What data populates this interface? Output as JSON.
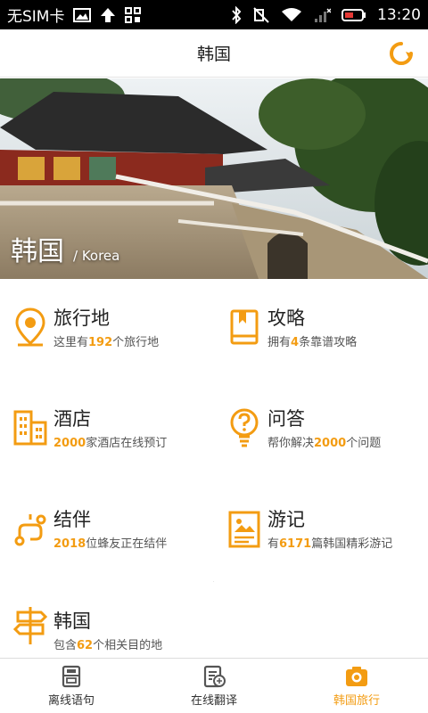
{
  "status_bar": {
    "carrier": "无SIM卡",
    "time": "13:20"
  },
  "header": {
    "title": "韩国"
  },
  "hero": {
    "title": "韩国",
    "subtitle": "/ Korea"
  },
  "grid": [
    {
      "name": "旅行地",
      "pre": "这里有",
      "hl": "192",
      "post": "个旅行地",
      "icon": "location-pin-icon"
    },
    {
      "name": "攻略",
      "pre": "拥有",
      "hl": "4",
      "post": "条靠谱攻略",
      "icon": "guidebook-icon"
    },
    {
      "name": "酒店",
      "pre": "",
      "hl": "2000",
      "post": "家酒店在线预订",
      "icon": "hotel-building-icon"
    },
    {
      "name": "问答",
      "pre": "帮你解决",
      "hl": "2000",
      "post": "个问题",
      "icon": "question-bulb-icon"
    },
    {
      "name": "结伴",
      "pre": "",
      "hl": "2018",
      "post": "位蜂友正在结伴",
      "icon": "route-icon"
    },
    {
      "name": "游记",
      "pre": "有",
      "hl": "6171",
      "post": "篇韩国精彩游记",
      "icon": "travelogue-icon"
    },
    {
      "name": "韩国",
      "pre": "包含",
      "hl": "62",
      "post": "个相关目的地",
      "icon": "signpost-icon"
    }
  ],
  "bottom_nav": [
    {
      "label": "离线语句",
      "icon": "phrasebook-icon",
      "active": false
    },
    {
      "label": "在线翻译",
      "icon": "translate-doc-icon",
      "active": false
    },
    {
      "label": "韩国旅行",
      "icon": "camera-icon",
      "active": true
    }
  ],
  "colors": {
    "accent": "#f39c12",
    "divider": "#e6e6e6"
  }
}
